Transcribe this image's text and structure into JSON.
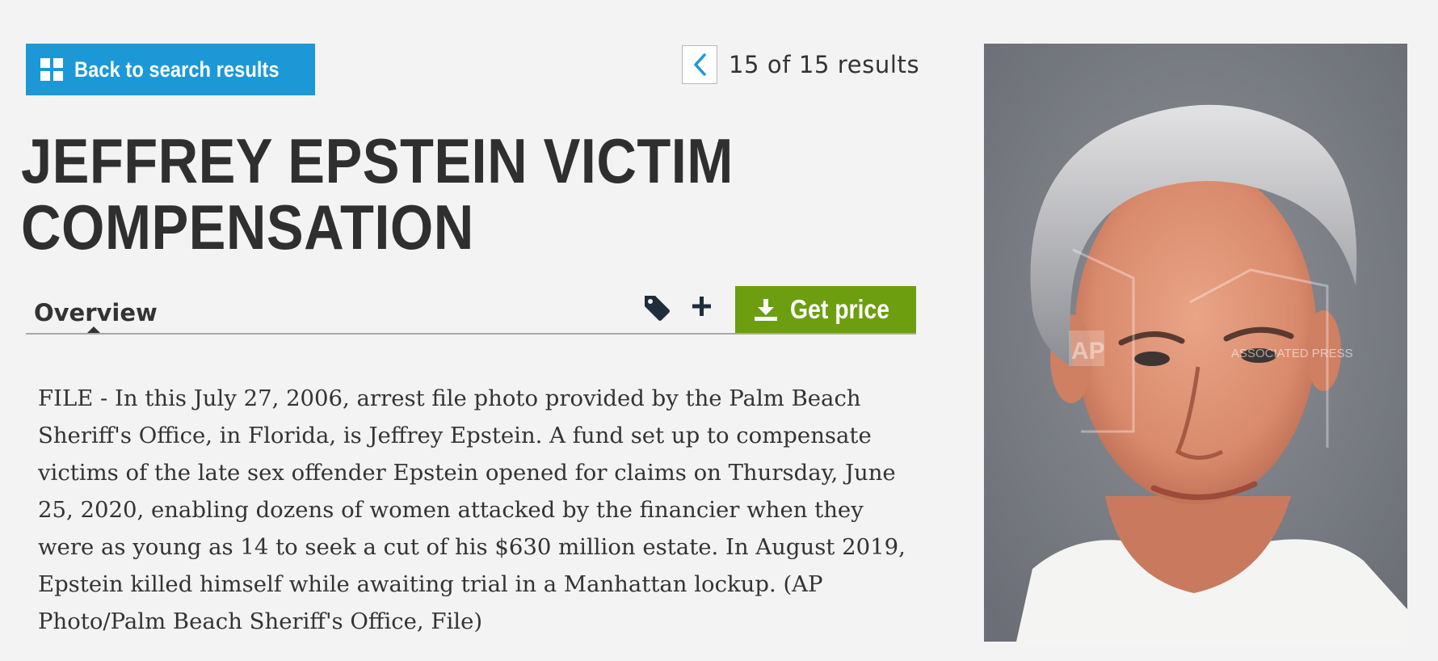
{
  "back_button": {
    "label": "Back to search results",
    "icon": "grid-icon"
  },
  "pager": {
    "text": "15 of 15 results",
    "icon": "chevron-left-icon"
  },
  "title": {
    "line1": "JEFFREY EPSTEIN VICTIM",
    "line2": "COMPENSATION"
  },
  "tabs": [
    {
      "label": "Overview",
      "active": true
    }
  ],
  "actions": {
    "tag_icon": "tag-icon",
    "add_icon": "plus-icon",
    "get_price_label": "Get price",
    "get_price_icon": "download-icon"
  },
  "caption": "FILE - In this July 27, 2006, arrest file photo provided by the Palm Beach Sheriff's Office, in Florida, is Jeffrey Epstein. A fund set up to compensate victims of the late sex offender Epstein opened for claims on Thursday, June 25, 2020, enabling dozens of women attacked by the financier when they were as young as 14 to seek a cut of his $630 million estate. In August 2019, Epstein killed himself while awaiting trial in a Manhattan lockup. (AP Photo/Palm Beach Sheriff's Office, File)",
  "photo": {
    "watermark_logo": "AP",
    "watermark_text": "ASSOCIATED PRESS"
  },
  "colors": {
    "back_button": "#1c98d7",
    "get_price": "#6c9e10",
    "background": "#f3f3f3",
    "text": "#333333"
  }
}
